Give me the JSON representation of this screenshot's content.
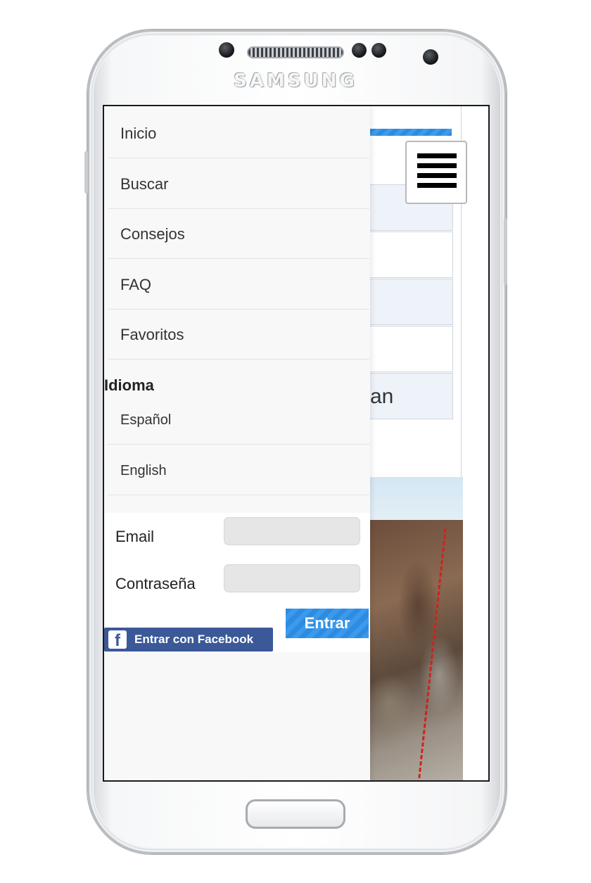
{
  "device": {
    "brand": "SAMSUNG"
  },
  "background_page": {
    "partial_row_text": "an"
  },
  "menu": {
    "items": [
      "Inicio",
      "Buscar",
      "Consejos",
      "FAQ",
      "Favoritos"
    ],
    "language_section": {
      "title": "Idioma",
      "options": [
        "Español",
        "English"
      ]
    }
  },
  "login": {
    "email_label": "Email",
    "email_value": "",
    "password_label": "Contraseña",
    "password_value": "",
    "submit_label": "Entrar",
    "facebook_label": "Entrar con Facebook"
  },
  "icons": {
    "menu": "hamburger-icon",
    "facebook": "facebook-icon"
  },
  "colors": {
    "accent": "#2c8ce3",
    "facebook": "#3b5998",
    "route": "#d0221d"
  }
}
